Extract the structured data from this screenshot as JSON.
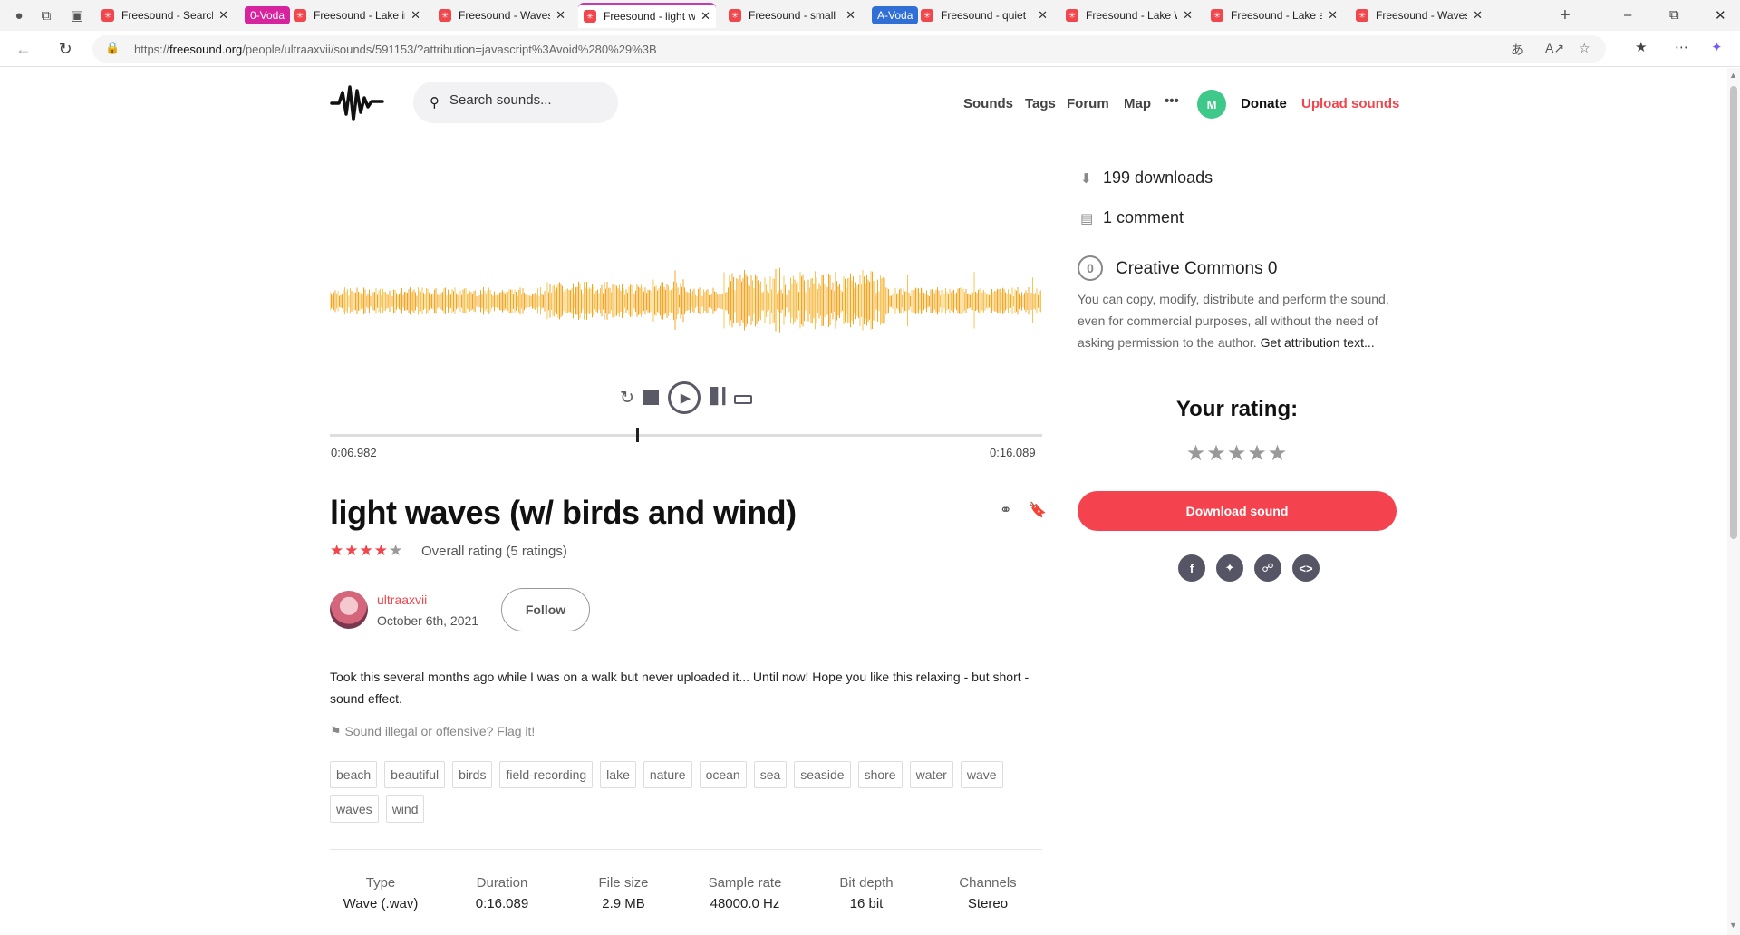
{
  "browser": {
    "tabs": [
      {
        "title": "Freesound - Search",
        "type": "tab"
      },
      {
        "title": "0-Voda",
        "type": "group",
        "color": "#d6249f"
      },
      {
        "title": "Freesound - Lake in",
        "type": "tab"
      },
      {
        "title": "Freesound - Waves",
        "type": "tab"
      },
      {
        "title": "Freesound - light w",
        "type": "active"
      },
      {
        "title": "Freesound - small",
        "type": "tab"
      },
      {
        "title": "A-Voda",
        "type": "group",
        "color": "#2f6fd6"
      },
      {
        "title": "Freesound - quiet",
        "type": "tab"
      },
      {
        "title": "Freesound - Lake W",
        "type": "tab"
      },
      {
        "title": "Freesound - Lake a",
        "type": "tab"
      },
      {
        "title": "Freesound - Waves",
        "type": "tab"
      }
    ],
    "url_prefix": "https://",
    "url_domain": "freesound.org",
    "url_path": "/people/ultraaxvii/sounds/591153/?attribution=javascript%3Avoid%280%29%3B"
  },
  "header": {
    "search_placeholder": "Search sounds...",
    "nav": [
      "Sounds",
      "Tags",
      "Forum",
      "Map"
    ],
    "more": "•••",
    "avatar_letter": "M",
    "donate": "Donate",
    "upload": "Upload sounds"
  },
  "player": {
    "current_time": "0:06.982",
    "total_time": "0:16.089",
    "progress_fraction": 0.43
  },
  "sound": {
    "title": "light waves (w/ birds and wind)",
    "rating_stars": 4,
    "overall_rating": "Overall rating (5 ratings)",
    "username": "ultraaxvii",
    "date": "October 6th, 2021",
    "follow": "Follow",
    "description": "Took this several months ago while I was on a walk but never uploaded it... Until now! Hope you like this relaxing - but short - sound effect.",
    "flag": "Sound illegal or offensive? Flag it!",
    "tags": [
      "beach",
      "beautiful",
      "birds",
      "field-recording",
      "lake",
      "nature",
      "ocean",
      "sea",
      "seaside",
      "shore",
      "water",
      "wave",
      "waves",
      "wind"
    ],
    "meta": [
      {
        "k": "Type",
        "v": "Wave (.wav)"
      },
      {
        "k": "Duration",
        "v": "0:16.089"
      },
      {
        "k": "File size",
        "v": "2.9 MB"
      },
      {
        "k": "Sample rate",
        "v": "48000.0 Hz"
      },
      {
        "k": "Bit depth",
        "v": "16 bit"
      },
      {
        "k": "Channels",
        "v": "Stereo"
      }
    ]
  },
  "sidebar": {
    "downloads": "199 downloads",
    "comments": "1 comment",
    "license_title": "Creative Commons 0",
    "license_text": "You can copy, modify, distribute and perform the sound, even for commercial purposes, all without the need of asking permission to the author.",
    "license_link": "Get attribution text...",
    "your_rating": "Your rating:",
    "download_button": "Download sound"
  },
  "colors": {
    "accent": "#f4434f",
    "wave": "#f4a623"
  }
}
